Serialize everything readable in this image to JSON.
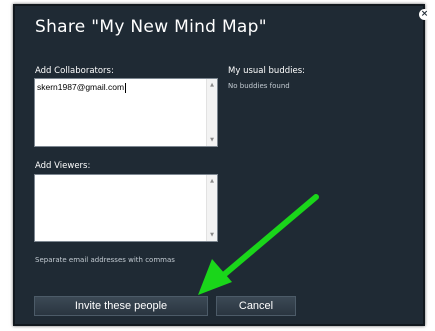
{
  "dialog": {
    "title": "Share \"My New Mind Map\"",
    "close_label": "×"
  },
  "collaborators": {
    "label": "Add Collaborators:",
    "value": "skern1987@gmail.com"
  },
  "buddies": {
    "label": "My usual buddies:",
    "empty_text": "No buddies found"
  },
  "viewers": {
    "label": "Add Viewers:",
    "value": ""
  },
  "hint": "Separate email addresses with commas",
  "buttons": {
    "invite": "Invite these people",
    "cancel": "Cancel"
  },
  "scroll": {
    "up": "▲",
    "down": "▼"
  },
  "colors": {
    "dialog_bg": "#1f2a34",
    "arrow": "#1ad61a"
  },
  "icons": {
    "close": "close-icon",
    "annotation_arrow": "arrow-annotation"
  }
}
